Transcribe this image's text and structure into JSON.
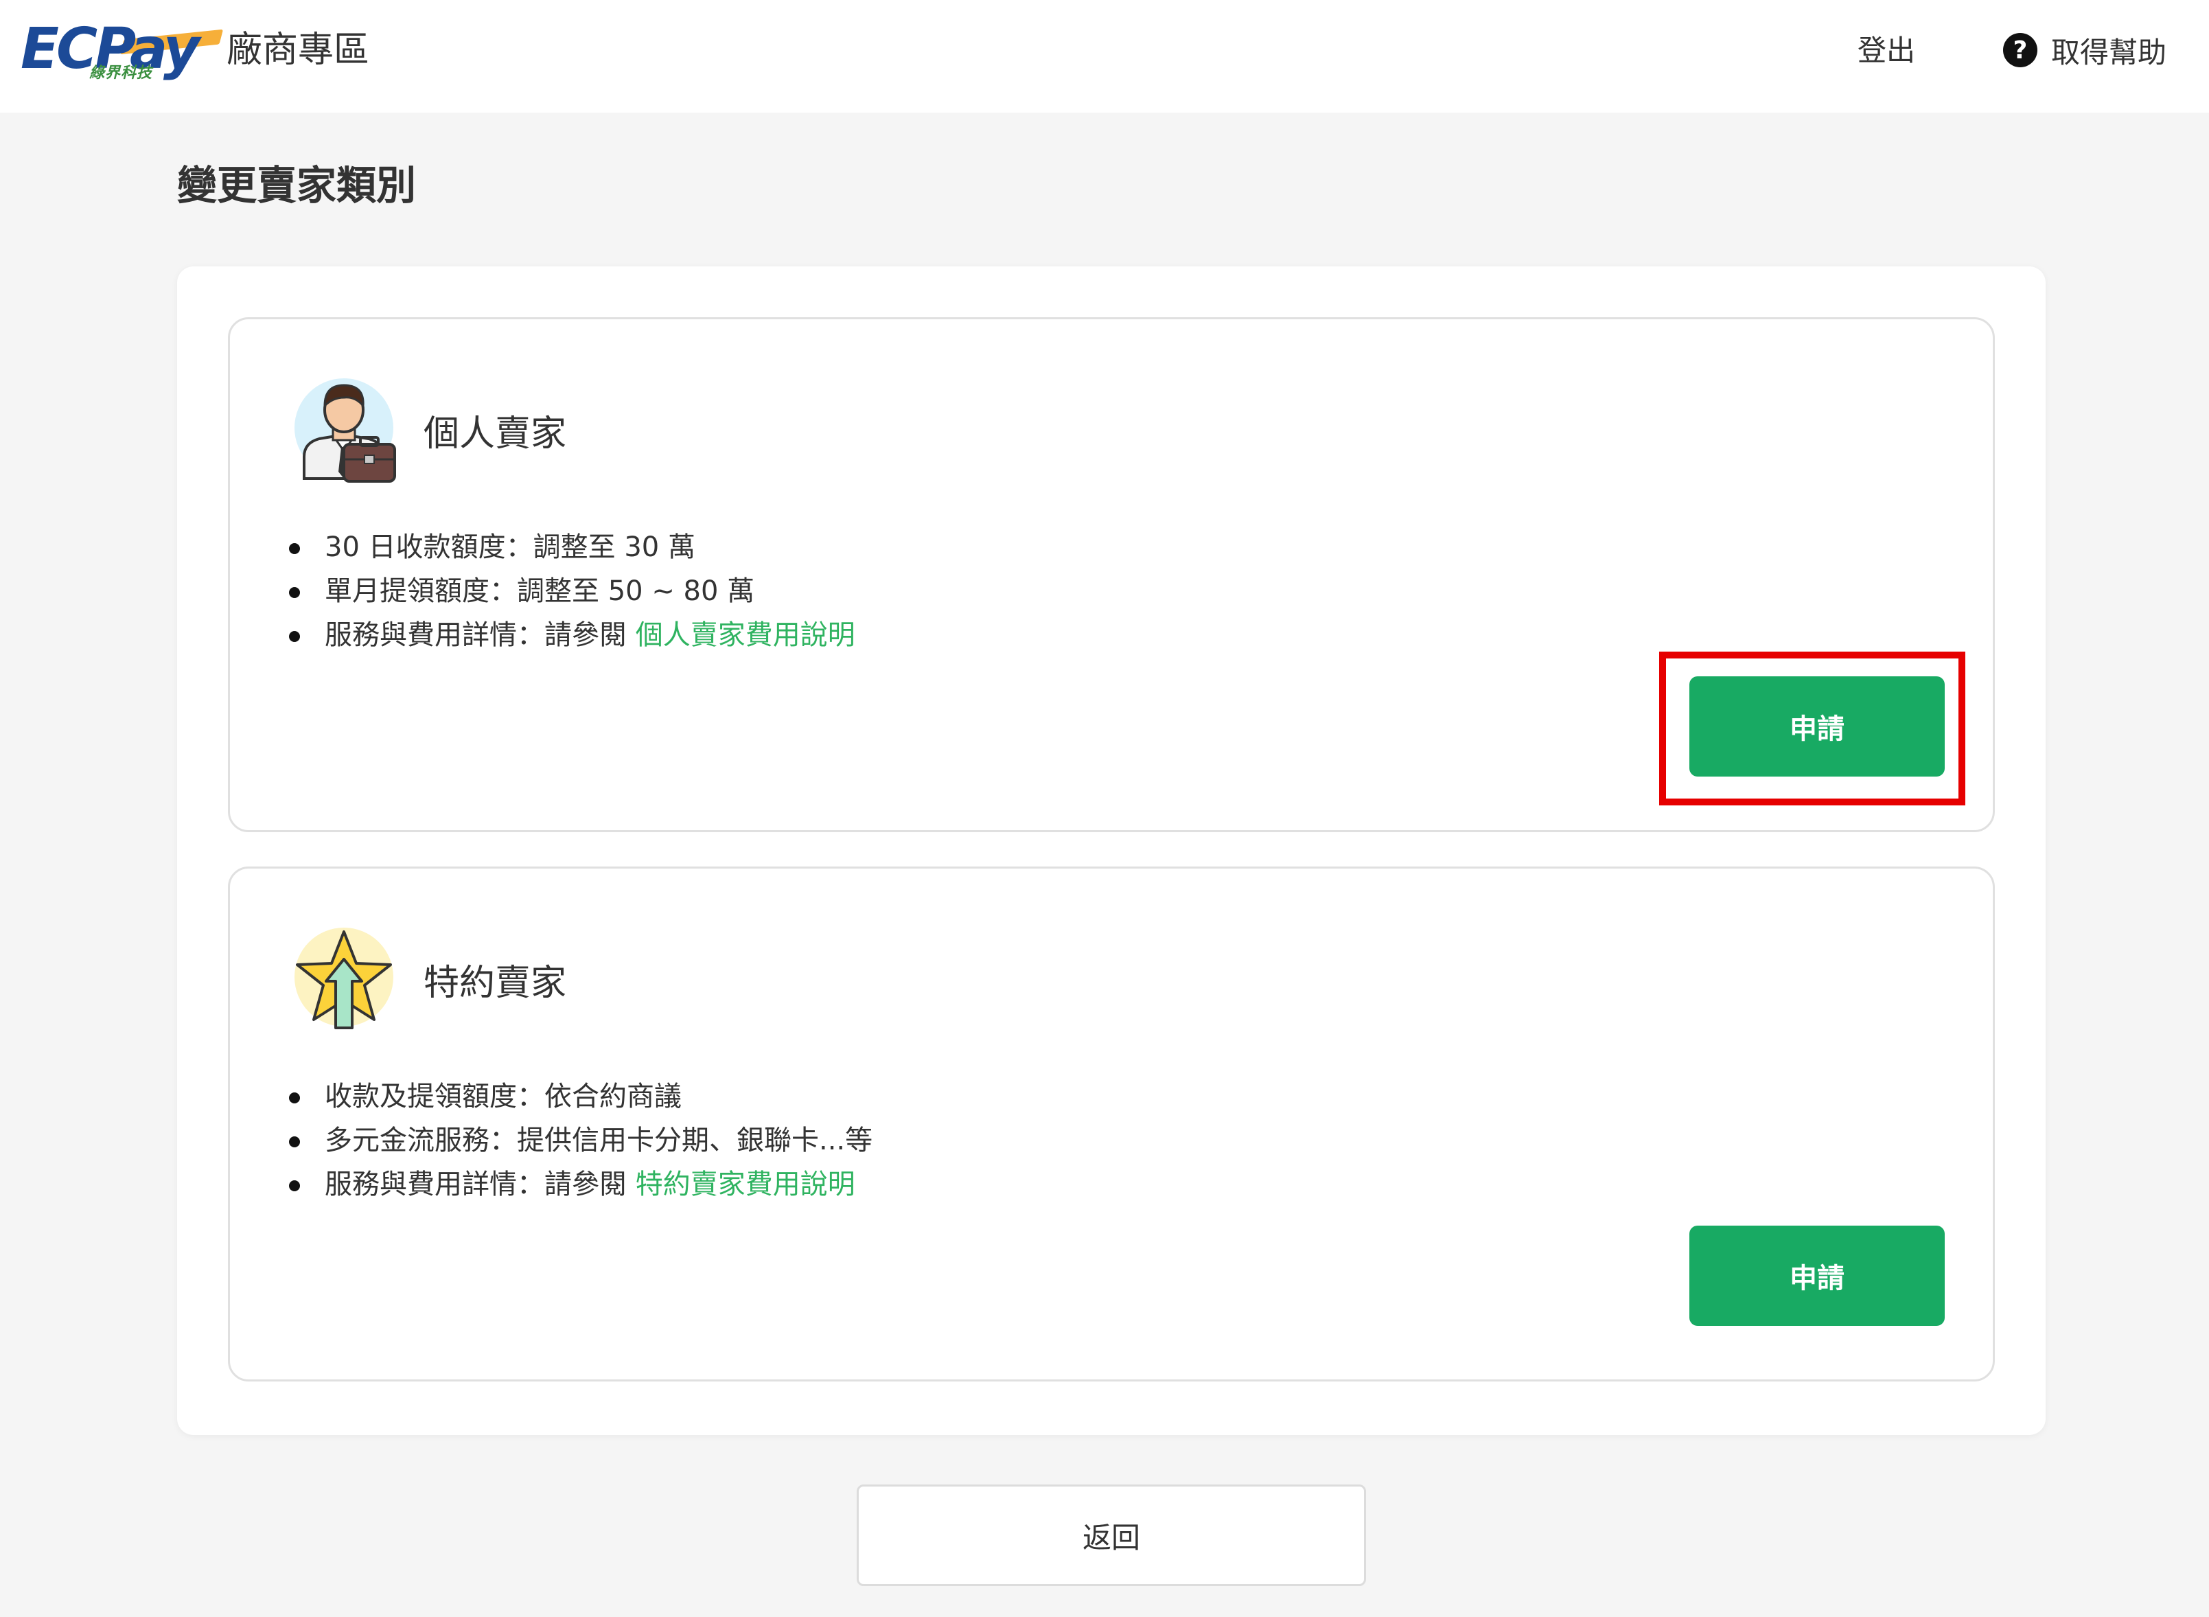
{
  "header": {
    "logo_main": "ECPay",
    "logo_sub": "綠界科技",
    "site_title": "廠商專區",
    "logout_label": "登出",
    "help_label": "取得幫助",
    "help_icon": "?"
  },
  "page": {
    "title": "變更賣家類別"
  },
  "cards": [
    {
      "icon": "businessperson-icon",
      "title": "個人賣家",
      "bullets": [
        "30 日收款額度：調整至 30 萬",
        "單月提領額度：調整至 50 ~ 80 萬"
      ],
      "detail_prefix": "服務與費用詳情：請參閱 ",
      "detail_link": "個人賣家費用說明",
      "apply_label": "申請",
      "highlighted": true
    },
    {
      "icon": "star-upgrade-icon",
      "title": "特約賣家",
      "bullets": [
        "收款及提領額度：依合約商議",
        "多元金流服務：提供信用卡分期、銀聯卡...等"
      ],
      "detail_prefix": "服務與費用詳情：請參閱 ",
      "detail_link": "特約賣家費用說明",
      "apply_label": "申請",
      "highlighted": false
    }
  ],
  "footer": {
    "back_label": "返回"
  },
  "colors": {
    "brand_blue": "#1c4a97",
    "accent_green": "#18aa63",
    "link_green": "#2fb360",
    "highlight_red": "#e60000"
  }
}
